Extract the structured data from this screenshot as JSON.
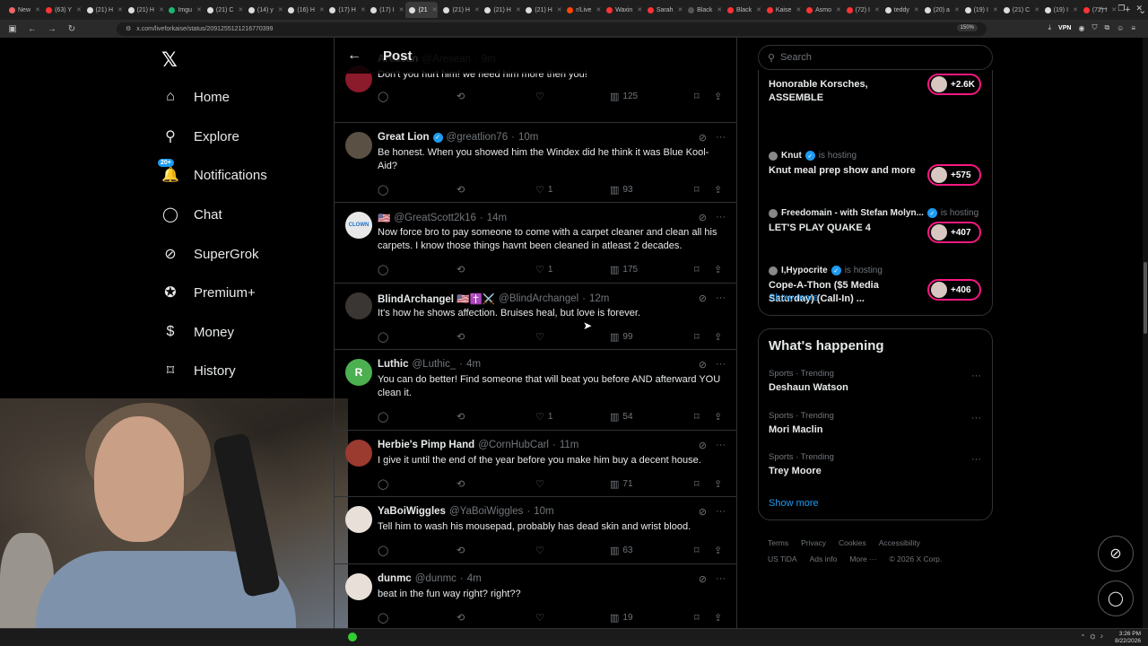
{
  "browser": {
    "tabs": [
      {
        "label": "New",
        "color": "#e66"
      },
      {
        "label": "(63) Y",
        "color": "#f33"
      },
      {
        "label": "(21) H",
        "color": "#ddd"
      },
      {
        "label": "(21) H",
        "color": "#ddd"
      },
      {
        "label": "Imgu",
        "color": "#1bb76e"
      },
      {
        "label": "(21) C",
        "color": "#ddd"
      },
      {
        "label": "(14) y",
        "color": "#ddd"
      },
      {
        "label": "(16) H",
        "color": "#ddd"
      },
      {
        "label": "(17) H",
        "color": "#ddd"
      },
      {
        "label": "(17) I",
        "color": "#ddd"
      },
      {
        "label": "(21",
        "color": "#ddd",
        "active": true
      },
      {
        "label": "(21) H",
        "color": "#ddd"
      },
      {
        "label": "(21) H",
        "color": "#ddd"
      },
      {
        "label": "(21) H",
        "color": "#ddd"
      },
      {
        "label": "r/Live",
        "color": "#ff4500"
      },
      {
        "label": "Waxin",
        "color": "#f33"
      },
      {
        "label": "Sarah",
        "color": "#f33"
      },
      {
        "label": "Black",
        "color": "#555"
      },
      {
        "label": "Black",
        "color": "#f33"
      },
      {
        "label": "Kaise",
        "color": "#f33"
      },
      {
        "label": "Asmo",
        "color": "#f33"
      },
      {
        "label": "(72) I",
        "color": "#f33"
      },
      {
        "label": "teddy",
        "color": "#ddd"
      },
      {
        "label": "(20) a",
        "color": "#ddd"
      },
      {
        "label": "(19) I",
        "color": "#ddd"
      },
      {
        "label": "(21) C",
        "color": "#ddd"
      },
      {
        "label": "(19) I",
        "color": "#ddd"
      },
      {
        "label": "(72) I",
        "color": "#f33"
      }
    ],
    "url": "x.com/liveforkaise/status/2091255121216770399",
    "zoom": "150%",
    "vpn_label": "VPN"
  },
  "nav": {
    "logo": "𝕏",
    "items": [
      {
        "label": "Home",
        "icon": "home-icon",
        "glyph": "⌂"
      },
      {
        "label": "Explore",
        "icon": "search-icon",
        "glyph": "⚲"
      },
      {
        "label": "Notifications",
        "icon": "bell-icon",
        "glyph": "🔔",
        "badge": "20+"
      },
      {
        "label": "Chat",
        "icon": "chat-icon",
        "glyph": "◯"
      },
      {
        "label": "SuperGrok",
        "icon": "grok-icon",
        "glyph": "⊘"
      },
      {
        "label": "Premium+",
        "icon": "premium-icon",
        "glyph": "✪"
      },
      {
        "label": "Money",
        "icon": "money-icon",
        "glyph": "$"
      },
      {
        "label": "History",
        "icon": "bookmark-icon",
        "glyph": "⌑"
      }
    ]
  },
  "header": {
    "title": "Post"
  },
  "replies": [
    {
      "name": "Aresean",
      "handle": "@Aresean",
      "time": "9m",
      "text": "Don't you hurt him! we need him more then you!",
      "reply": "",
      "retweet": "",
      "like": "",
      "views": "125",
      "avatar_color": "#8b1a2b",
      "avatar_letter": ""
    },
    {
      "name": "Great Lion",
      "verified": true,
      "handle": "@greatlion76",
      "time": "10m",
      "text": "Be honest. When you showed him the Windex did he think it was Blue Kool-Aid?",
      "reply": "",
      "retweet": "",
      "like": "1",
      "views": "93",
      "avatar_color": "#5a5043",
      "avatar_letter": ""
    },
    {
      "name": "🇺🇸",
      "handle": "@GreatScott2k16",
      "time": "14m",
      "text": "Now force bro to pay someone to come with a carpet cleaner and clean all his carpets. I know those things havnt been cleaned in atleast 2 decades.",
      "reply": "",
      "retweet": "",
      "like": "1",
      "views": "175",
      "avatar_color": "#e8e8e8",
      "avatar_letter": "CLOWN"
    },
    {
      "name": "BlindArchangel 🇺🇸✝️⚔️",
      "handle": "@BlindArchangel",
      "time": "12m",
      "text": "It's how he shows affection. Bruises heal, but love is forever.",
      "reply": "",
      "retweet": "",
      "like": "",
      "views": "99",
      "avatar_color": "#3a3633",
      "avatar_letter": ""
    },
    {
      "name": "Luthic",
      "handle": "@Luthic_",
      "time": "4m",
      "text": "You can do better!  Find someone that will beat you before AND afterward YOU clean it.",
      "reply": "",
      "retweet": "",
      "like": "1",
      "views": "54",
      "avatar_color": "#4caf50",
      "avatar_letter": "R"
    },
    {
      "name": "Herbie's Pimp Hand",
      "handle": "@CornHubCarl",
      "time": "11m",
      "text": "I give it until the end of the year before you make him buy a decent house.",
      "reply": "",
      "retweet": "",
      "like": "",
      "views": "71",
      "avatar_color": "#9b3a2e",
      "avatar_letter": ""
    },
    {
      "name": "YaBoiWiggles",
      "handle": "@YaBoiWiggles",
      "time": "10m",
      "text": "Tell him to wash his mousepad, probably has dead skin and wrist blood.",
      "reply": "",
      "retweet": "",
      "like": "",
      "views": "63",
      "avatar_color": "#e8e0d8",
      "avatar_letter": ""
    },
    {
      "name": "dunmc",
      "handle": "@dunmc",
      "time": "4m",
      "text": "beat in the fun way right? right??",
      "reply": "",
      "retweet": "",
      "like": "",
      "views": "19",
      "avatar_color": "#e8e0d8",
      "avatar_letter": ""
    }
  ],
  "search": {
    "placeholder": "Search"
  },
  "spaces": [
    {
      "host": "",
      "status": "",
      "title": "Honorable Korsches, ASSEMBLE",
      "count": "+2.6K"
    },
    {
      "host": "Knut",
      "verified": true,
      "status": "is hosting",
      "title": "Knut meal prep show and more",
      "count": "+575"
    },
    {
      "host": "Freedomain - with Stefan Molyn...",
      "verified": true,
      "status": "is hosting",
      "title": "LET'S PLAY QUAKE 4",
      "count": "+407"
    },
    {
      "host": "I,Hypocrite",
      "verified": true,
      "status": "is hosting",
      "title": "Cope-A-Thon ($5 Media Saturday) (Call-In) ...",
      "count": "+406"
    }
  ],
  "spaces_show_more": "Show more",
  "happening": {
    "title": "What's happening",
    "trends": [
      {
        "meta": "Sports · Trending",
        "name": "Deshaun Watson"
      },
      {
        "meta": "Sports · Trending",
        "name": "Mori Maclin"
      },
      {
        "meta": "Sports · Trending",
        "name": "Trey Moore"
      }
    ],
    "show_more": "Show more"
  },
  "footer": {
    "links": [
      "Terms",
      "Privacy",
      "Cookies",
      "Accessibility",
      "US TiDA",
      "Ads info",
      "More ···",
      "© 2026 X Corp."
    ]
  },
  "taskbar": {
    "time": "3:26 PM",
    "date": "8/22/2026"
  }
}
